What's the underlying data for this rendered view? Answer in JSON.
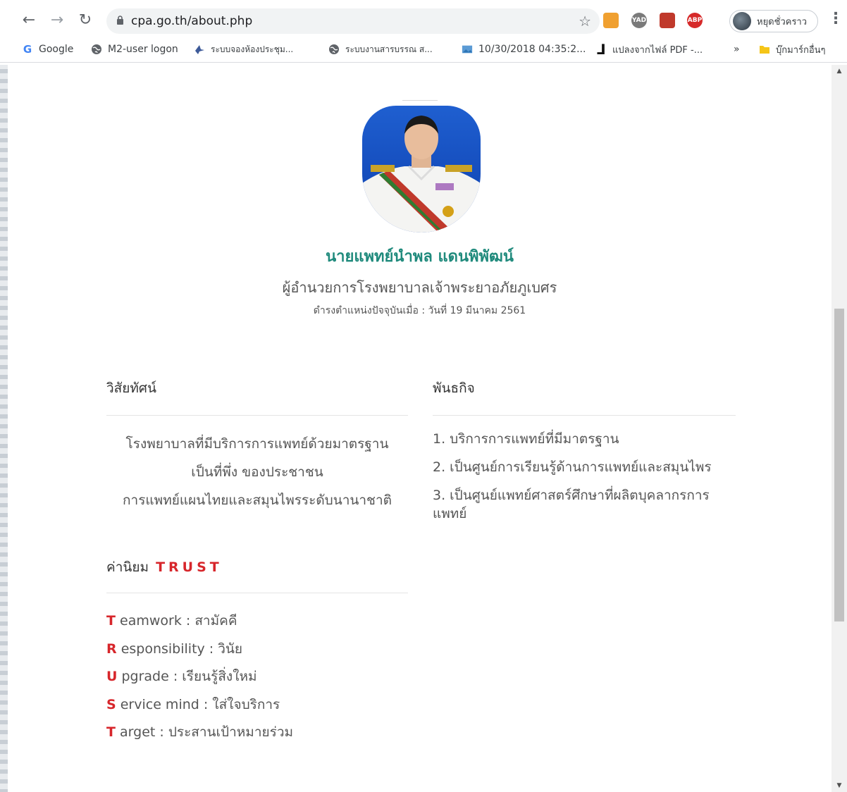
{
  "browser": {
    "url": "cpa.go.th/about.php",
    "profile_label": "หยุดชั่วคราว",
    "bookmarks": [
      {
        "label": "Google",
        "icon": "google-icon"
      },
      {
        "label": "M2-user logon",
        "icon": "globe-icon"
      },
      {
        "label": "ระบบจองห้องประชุม...",
        "icon": "bird-icon"
      },
      {
        "label": "ระบบงานสารบรรณ ส...",
        "icon": "globe-icon"
      },
      {
        "label": "10/30/2018 04:35:2...",
        "icon": "image-icon"
      },
      {
        "label": "แปลงจากไฟล์ PDF -...",
        "icon": "j-icon"
      }
    ],
    "more_bookmarks": "»",
    "other_bookmarks": "บุ๊กมาร์กอื่นๆ",
    "extensions": [
      {
        "name": "office-icon",
        "label": "",
        "color": "#f0a030"
      },
      {
        "name": "yad-icon",
        "label": "YAD",
        "color": "#7a7a7a"
      },
      {
        "name": "pdf-icon",
        "label": "",
        "color": "#c0392b"
      },
      {
        "name": "abp-icon",
        "label": "ABP",
        "color": "#d62a2a"
      }
    ]
  },
  "profile": {
    "name": "นายแพทย์นำพล แดนพิพัฒน์",
    "position": "ผู้อำนวยการโรงพยาบาลเจ้าพระยาอภัยภูเบศร",
    "since": "ดำรงตำแหน่งปัจจุบันเมื่อ : วันที่ 19 มีนาคม 2561"
  },
  "vision": {
    "title": "วิสัยทัศน์",
    "lines": [
      "โรงพยาบาลที่มีบริการการแพทย์ด้วยมาตรฐาน",
      "เป็นที่พึ่ง ของประชาชน",
      "การแพทย์แผนไทยและสมุนไพรระดับนานาชาติ"
    ]
  },
  "mission": {
    "title": "พันธกิจ",
    "items": [
      "1. บริการการแพทย์ที่มีมาตรฐาน",
      "2. เป็นศูนย์การเรียนรู้ด้านการแพทย์และสมุนไพร",
      "3. เป็นศูนย์แพทย์ศาสตร์ศึกษาที่ผลิตบุคลากรการแพทย์"
    ]
  },
  "values": {
    "title": "ค่านิยม",
    "accent": "TRUST",
    "items": [
      {
        "letter": "T",
        "rest": "eamwork : สามัคคี"
      },
      {
        "letter": "R",
        "rest": "esponsibility : วินัย"
      },
      {
        "letter": "U",
        "rest": "pgrade : เรียนรู้สิ่งใหม่"
      },
      {
        "letter": "S",
        "rest": "ervice mind : ใส่ใจบริการ"
      },
      {
        "letter": "T",
        "rest": "arget : ประสานเป้าหมายร่วม"
      }
    ]
  },
  "colors": {
    "name": "#1f8a7c",
    "accent": "#d7262b"
  }
}
